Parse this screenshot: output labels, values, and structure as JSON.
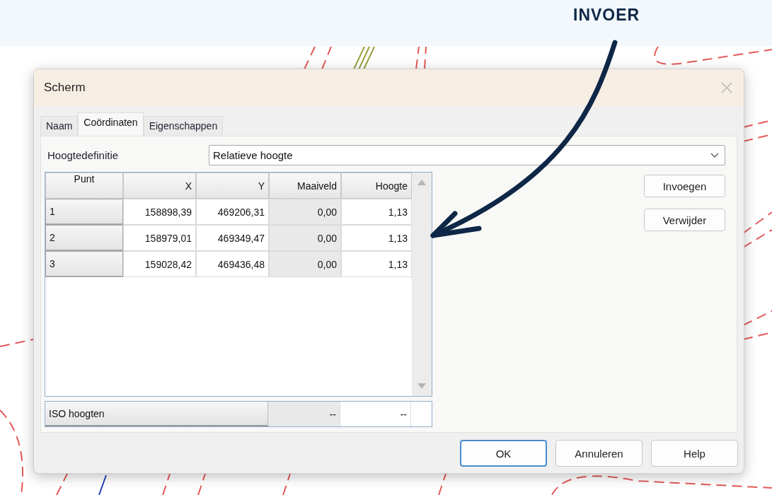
{
  "annotation": {
    "label": "INVOER"
  },
  "dialog": {
    "title": "Scherm",
    "tabs": [
      {
        "label": "Naam",
        "selected": false
      },
      {
        "label": "Coördinaten",
        "selected": true
      },
      {
        "label": "Eigenschappen",
        "selected": false
      }
    ],
    "height_definition": {
      "label": "Hoogtedefinitie",
      "value": "Relatieve hoogte"
    },
    "table": {
      "columns": [
        "Punt",
        "X",
        "Y",
        "Maaiveld",
        "Hoogte"
      ],
      "rows": [
        {
          "cells": [
            "1",
            "158898,39",
            "469206,31",
            "0,00",
            "1,13"
          ]
        },
        {
          "cells": [
            "2",
            "158979,01",
            "469349,47",
            "0,00",
            "1,13"
          ]
        },
        {
          "cells": [
            "3",
            "159028,42",
            "469436,48",
            "0,00",
            "1,13"
          ]
        }
      ],
      "footer": {
        "label": "ISO hoogten",
        "cells": [
          "--",
          "--"
        ]
      }
    },
    "side_buttons": [
      "Invoegen",
      "Verwijder"
    ],
    "buttons": [
      {
        "label": "OK",
        "default": true
      },
      {
        "label": "Annuleren",
        "default": false
      },
      {
        "label": "Help",
        "default": false
      }
    ]
  }
}
